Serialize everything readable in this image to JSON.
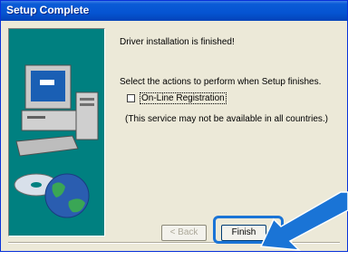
{
  "window": {
    "title": "Setup Complete"
  },
  "message": {
    "line1": "Driver installation is finished!",
    "line2": "Select the actions to perform when Setup finishes."
  },
  "option": {
    "label": "On-Line Registration",
    "checked": false,
    "note": "(This service may not be available in all countries.)"
  },
  "buttons": {
    "back": "< Back",
    "finish": "Finish"
  },
  "colors": {
    "highlight": "#1a74d6",
    "arrow": "#1a74d6",
    "title_bar": "#0554d2"
  },
  "icons": [
    "computer-illustration",
    "disc-icon",
    "globe-icon",
    "pointer-arrow-icon"
  ]
}
